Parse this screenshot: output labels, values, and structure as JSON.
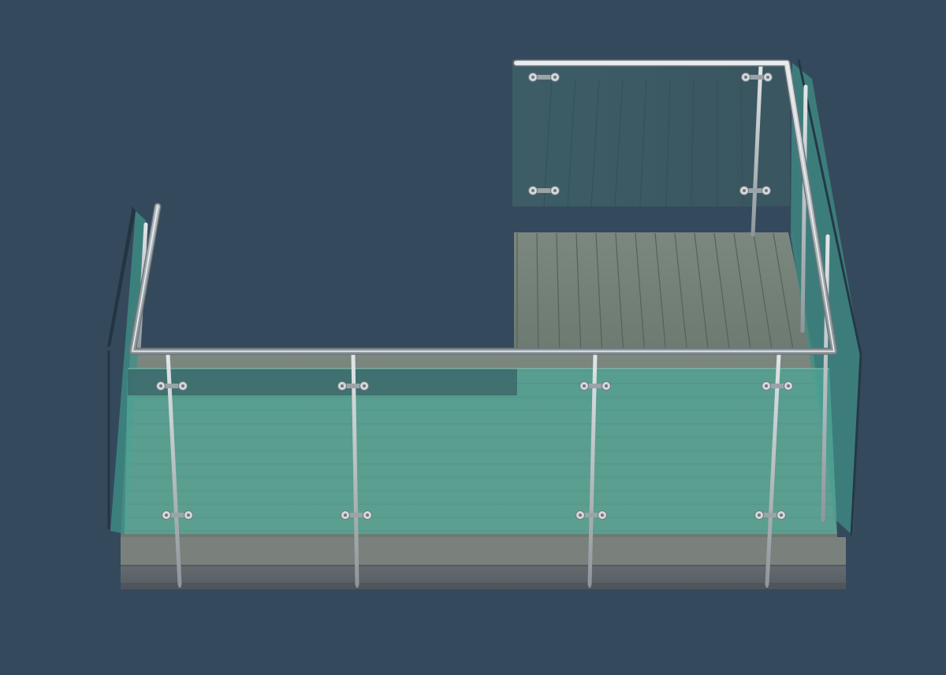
{
  "scene": {
    "subject": "balcony-glass-railing-render",
    "colors": {
      "background": "#35495d",
      "deck": "#6f7d76",
      "deck_board_line": "#4e5a54",
      "deck_edge": "#7e8780",
      "frame_base": "#646b70",
      "glass": "#4fa897",
      "glass_back": "#3c5a63",
      "steel": "#b8bfc4",
      "steel_dark": "#7c858b"
    }
  }
}
